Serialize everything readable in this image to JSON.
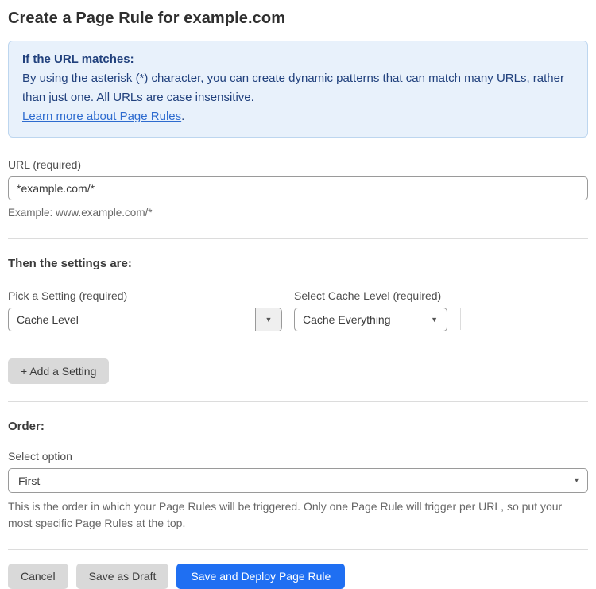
{
  "page": {
    "title": "Create a Page Rule for example.com"
  },
  "info_box": {
    "heading": "If the URL matches:",
    "body": "By using the asterisk (*) character, you can create dynamic patterns that can match many URLs, rather than just one. All URLs are case insensitive.",
    "link_label": "Learn more about Page Rules",
    "link_suffix": "."
  },
  "url_field": {
    "label": "URL (required)",
    "value": "*example.com/*",
    "helper": "Example: www.example.com/*"
  },
  "settings_section": {
    "heading": "Then the settings are:",
    "setting_picker": {
      "label": "Pick a Setting (required)",
      "value": "Cache Level"
    },
    "cache_level_picker": {
      "label": "Select Cache Level (required)",
      "value": "Cache Everything"
    },
    "add_setting_label": "+ Add a Setting"
  },
  "order_section": {
    "heading": "Order:",
    "label": "Select option",
    "value": "First",
    "helper": "This is the order in which your Page Rules will be triggered. Only one Page Rule will trigger per URL, so put your most specific Page Rules at the top."
  },
  "actions": {
    "cancel": "Cancel",
    "save_draft": "Save as Draft",
    "save_deploy": "Save and Deploy Page Rule"
  },
  "icons": {
    "dropdown_arrow": "▼"
  },
  "colors": {
    "accent_blue": "#1f6ff2",
    "info_bg": "#e8f1fb",
    "info_border": "#bdd6ef",
    "info_text": "#21417d",
    "link_blue": "#2d6bcf",
    "button_gray": "#d9d9d9"
  }
}
